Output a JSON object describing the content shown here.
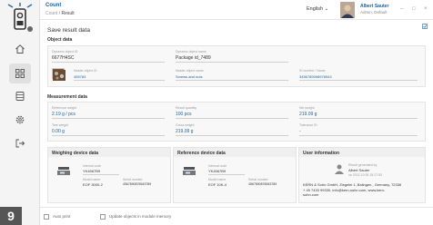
{
  "header": {
    "app_title": "Count",
    "breadcrumb_root": "Count",
    "breadcrumb_sep": "/",
    "breadcrumb_current": "Result",
    "language": "English",
    "language_chevron": "⌄",
    "user_name": "Albert Sauter",
    "user_role": "Admin, Default",
    "minimize": "–",
    "maximize": "□",
    "close": "×"
  },
  "sidebar": {
    "items": [
      "home-icon",
      "apps-icon",
      "database-icon",
      "settings-icon",
      "logout-icon"
    ],
    "active_index": 1
  },
  "step_number": "9",
  "page": {
    "title": "Save result data"
  },
  "object_data": {
    "title": "Object data",
    "dynamic_id_label": "Dynamic object ID",
    "dynamic_id_value": "6677H4SC",
    "dynamic_name_label": "Dynamic object name",
    "dynamic_name_value": "Package id_7489",
    "master_id_label": "Master object ID",
    "master_id_value": "455783",
    "master_name_label": "Master object name",
    "master_name_value": "Screws and nuts",
    "article_label": "ID number / Name",
    "article_value": "3456789098976543"
  },
  "measurement": {
    "title": "Measurement data",
    "ref_weight_label": "Reference weight",
    "ref_weight_value": "2.19 g / pcs",
    "result_qty_label": "Result quantity",
    "result_qty_value": "100 pcs",
    "net_weight_label": "Net weight",
    "net_weight_value": "219.09 g",
    "tare_label": "Tare weight",
    "tare_value": "0.00 g",
    "gross_label": "Gross weight",
    "gross_value": "219.09 g",
    "tolerance_label": "Tolerance ID",
    "tolerance_value": "-"
  },
  "weighing_device": {
    "title": "Weighing device data",
    "internal_code_label": "Internal code",
    "internal_code_value": "YK4567B9",
    "model_label": "Model name",
    "model_value": "EOF 3000-2",
    "serial_label": "Serial number",
    "serial_value": "4567890876543789"
  },
  "reference_device": {
    "title": "Reference device data",
    "internal_code_label": "Internal code",
    "internal_code_value": "YK4567B9",
    "model_label": "Model name",
    "model_value": "EOF 10K-4",
    "serial_label": "Serial number",
    "serial_value": "4567890876543789"
  },
  "user_info": {
    "title": "User information",
    "generated_label": "Result generated by",
    "generated_name": "Albert Sauter",
    "generated_date": "on 2022 10 05 15:27:53",
    "company_line1": "KERN & Sohn GmbH, Ziegelei 1, Balingen , Germany, 72336",
    "company_line2": "+ 49 7433 99330, info@kern-sohn.com, www.kern-",
    "company_line3": "sohn.com"
  },
  "bottom": {
    "auto_print_label": "Auto print",
    "update_memory_label": "Update objects in module memory"
  },
  "colors": {
    "accent": "#1b5f9e",
    "panel": "#f8f8f8",
    "badge": "#555555"
  }
}
